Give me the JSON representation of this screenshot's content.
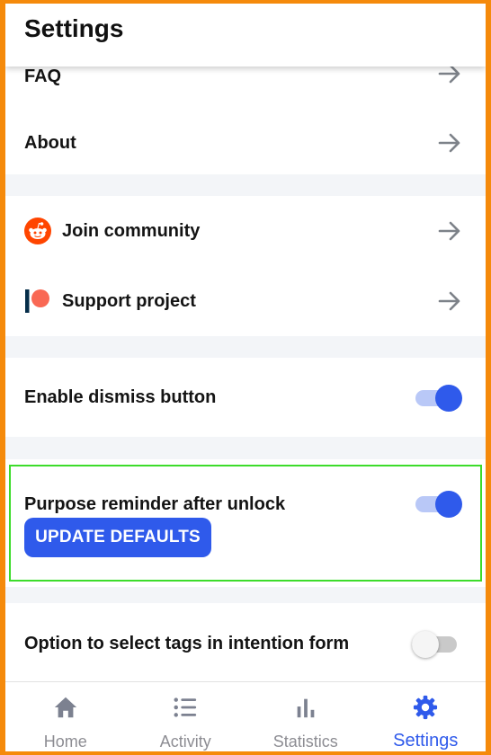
{
  "header": {
    "title": "Settings"
  },
  "rows": {
    "faq": "FAQ",
    "about": "About",
    "join_community": "Join community",
    "support_project": "Support project",
    "enable_dismiss": "Enable dismiss button",
    "purpose_reminder": "Purpose reminder after unlock",
    "select_tags": "Option to select tags in intention form"
  },
  "toggles": {
    "enable_dismiss": true,
    "purpose_reminder": true,
    "select_tags": false
  },
  "buttons": {
    "update_defaults": "UPDATE DEFAULTS"
  },
  "bottom_nav": {
    "items": [
      {
        "label": "Home",
        "icon": "home-icon",
        "active": false
      },
      {
        "label": "Activity",
        "icon": "list-icon",
        "active": false
      },
      {
        "label": "Statistics",
        "icon": "bar-chart-icon",
        "active": false
      },
      {
        "label": "Settings",
        "icon": "gear-icon",
        "active": true
      }
    ]
  },
  "colors": {
    "accent": "#2f5aeb",
    "reddit_orange": "#ff4500",
    "patreon_red": "#f96854",
    "frame_orange": "#f58a0b",
    "highlight_green": "#3ddc2b"
  }
}
